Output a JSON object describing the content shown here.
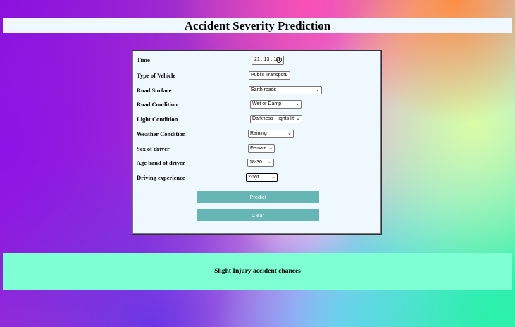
{
  "header": {
    "title": "Accident Severity Prediction"
  },
  "form": {
    "fields": [
      {
        "label": "Time",
        "value": "21 : 13 : 12"
      },
      {
        "label": "Type of Vehicle",
        "value": "Public Transport"
      },
      {
        "label": "Road Surface",
        "value": "Earth roads"
      },
      {
        "label": "Road Condition",
        "value": "Wet or Damp"
      },
      {
        "label": "Light Condition",
        "value": "Darkness - lights lit"
      },
      {
        "label": "Weather Condition",
        "value": "Raining"
      },
      {
        "label": "Sex of driver",
        "value": "Female"
      },
      {
        "label": "Age band of driver",
        "value": "18-30"
      },
      {
        "label": "Driving experience",
        "value": "2-5yr"
      }
    ],
    "predict_label": "Predict",
    "clear_label": "Clear"
  },
  "result": {
    "text": "Slight Injury accident chances"
  },
  "colors": {
    "panel_bg": "#f0f8ff",
    "button_bg": "#66b6b6",
    "result_bg": "#7fffd4"
  },
  "icons": {
    "time_picker": "clock-icon",
    "dropdown": "chevron-down-icon"
  }
}
